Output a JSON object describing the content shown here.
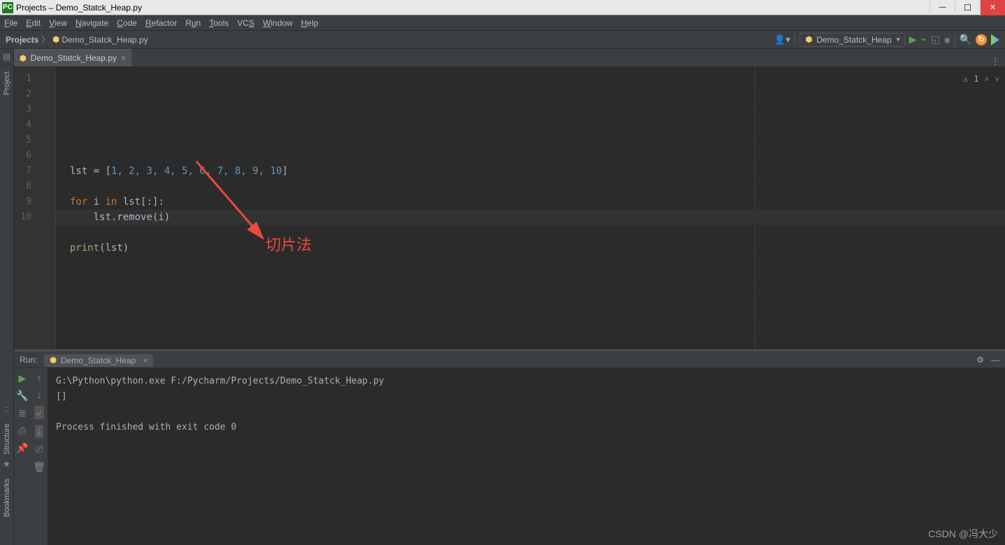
{
  "titlebar": {
    "title": "Projects – Demo_Statck_Heap.py"
  },
  "menu": {
    "file": "File",
    "edit": "Edit",
    "view": "View",
    "navigate": "Navigate",
    "code": "Code",
    "refactor": "Refactor",
    "run": "Run",
    "tools": "Tools",
    "vcs": "VCS",
    "window": "Window",
    "help": "Help"
  },
  "breadcrumb": {
    "root": "Projects",
    "file": "Demo_Statck_Heap.py"
  },
  "run_config": {
    "name": "Demo_Statck_Heap"
  },
  "editor_tab": {
    "name": "Demo_Statck_Heap.py"
  },
  "gutter_lines": [
    "1",
    "2",
    "3",
    "4",
    "5",
    "6",
    "7",
    "8",
    "9",
    "10"
  ],
  "code": {
    "l1a": "lst = [",
    "l1nums": "1, 2, 3, 4, 5, 6, 7, 8, 9, 10",
    "l1b": "]",
    "l3_for": "for",
    "l3_i": " i ",
    "l3_in": "in",
    "l3_rest": " lst[:]:",
    "l4": "    lst.remove(i)",
    "l6_print": "print",
    "l6_rest": "(lst)"
  },
  "annotation": {
    "text": "切片法"
  },
  "problems": {
    "count": "1"
  },
  "left_tools": {
    "project": "Project",
    "structure": "Structure",
    "bookmarks": "Bookmarks"
  },
  "run_panel": {
    "label": "Run:",
    "tab": "Demo_Statck_Heap",
    "line1": "G:\\Python\\python.exe F:/Pycharm/Projects/Demo_Statck_Heap.py",
    "line2": "[]",
    "line3": "",
    "line4": "Process finished with exit code 0"
  },
  "watermark": "CSDN @冯大少"
}
